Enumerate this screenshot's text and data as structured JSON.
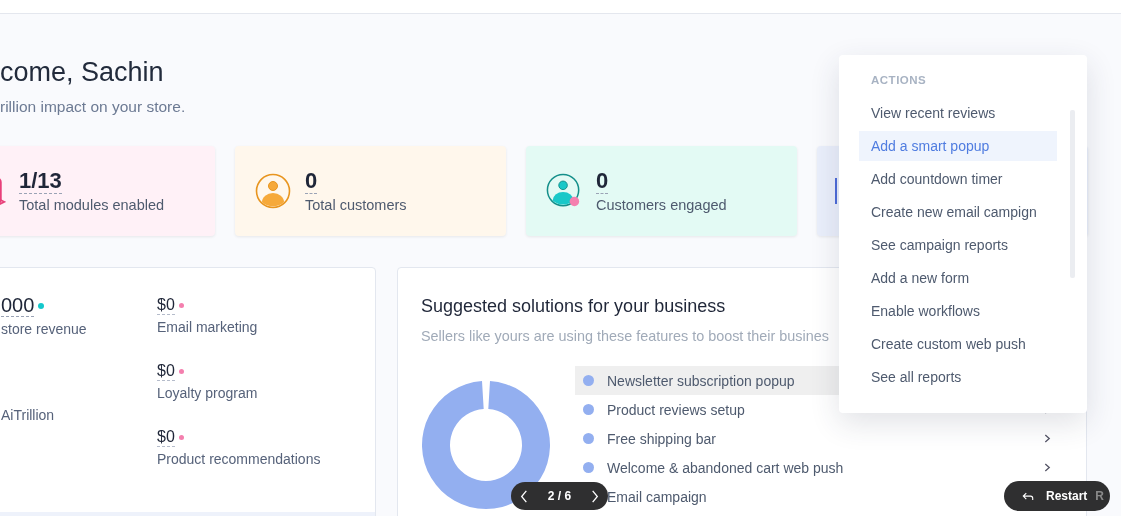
{
  "header": {
    "title": "come, Sachin",
    "subtitle": "rillion impact on your store."
  },
  "stats": [
    {
      "kind": "modules",
      "value": "1/13",
      "label": "Total modules enabled"
    },
    {
      "kind": "customers",
      "value": "0",
      "label": "Total customers"
    },
    {
      "kind": "engaged",
      "value": "0",
      "label": "Customers engaged"
    },
    {
      "kind": "partial"
    }
  ],
  "revenue": {
    "total": {
      "value": "000",
      "label": "store revenue",
      "color": "#14c8cc"
    },
    "source": "AiTrillion",
    "breakdown": [
      {
        "value": "$0",
        "label": "Email marketing",
        "color": "#f47fae"
      },
      {
        "value": "$0",
        "label": "Loyalty program",
        "color": "#f47fae"
      },
      {
        "value": "$0",
        "label": "Product recommendations",
        "color": "#f47fae"
      }
    ]
  },
  "suggestions": {
    "title": "Suggested solutions for your business",
    "subtitle": "Sellers like yours are using these features to boost their busines",
    "items": [
      {
        "label": "Newsletter subscription popup",
        "selected": true
      },
      {
        "label": "Product reviews setup",
        "selected": false
      },
      {
        "label": "Free shipping bar",
        "selected": false
      },
      {
        "label": "Welcome & abandoned cart web push",
        "selected": false
      },
      {
        "label": "Email campaign",
        "selected": false
      }
    ]
  },
  "actions": {
    "heading": "ACTIONS",
    "items": [
      {
        "label": "View recent reviews",
        "selected": false
      },
      {
        "label": "Add a smart popup",
        "selected": true
      },
      {
        "label": "Add countdown timer",
        "selected": false
      },
      {
        "label": "Create new email campign",
        "selected": false
      },
      {
        "label": "See campaign reports",
        "selected": false
      },
      {
        "label": "Add a new form",
        "selected": false
      },
      {
        "label": "Enable workflows",
        "selected": false
      },
      {
        "label": "Create custom web push",
        "selected": false
      },
      {
        "label": "See all reports",
        "selected": false
      }
    ]
  },
  "pager": {
    "text": "2 / 6"
  },
  "restart": {
    "label": "Restart",
    "shortcut": "R"
  }
}
